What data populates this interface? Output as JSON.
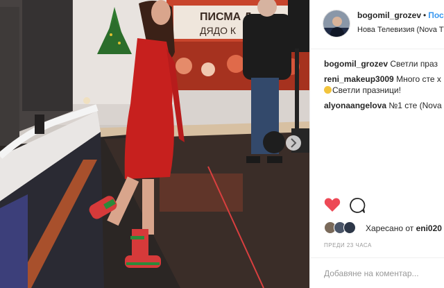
{
  "photo": {
    "banner_text_line1": "ПИСМА Д",
    "banner_text_line2": "ДЯДО К"
  },
  "post": {
    "header": {
      "username": "bogomil_grozev",
      "separator": "•",
      "follow_label": "Пос",
      "location": "Нова Телевизия (Nova TV"
    },
    "comments": [
      {
        "user": "bogomil_grozev",
        "text": "Светли праз"
      },
      {
        "user": "reni_makeup3009",
        "text": "Много сте х",
        "continuation": "Светли празници!"
      },
      {
        "user": "alyonaangelova",
        "text": "№1 сте (Nova"
      }
    ],
    "likes": {
      "prefix": "Харесано от",
      "user": "eni020"
    },
    "timestamp": "ПРЕДИ 23 ЧАСА",
    "comment_placeholder": "Добавяне на коментар...",
    "colors": {
      "like_red": "#ed4956",
      "link_blue": "#3897f0",
      "text": "#262626",
      "muted": "#999999"
    },
    "icons": {
      "like": "heart-icon",
      "comment": "speech-bubble-icon",
      "next": "chevron-right-icon"
    }
  }
}
